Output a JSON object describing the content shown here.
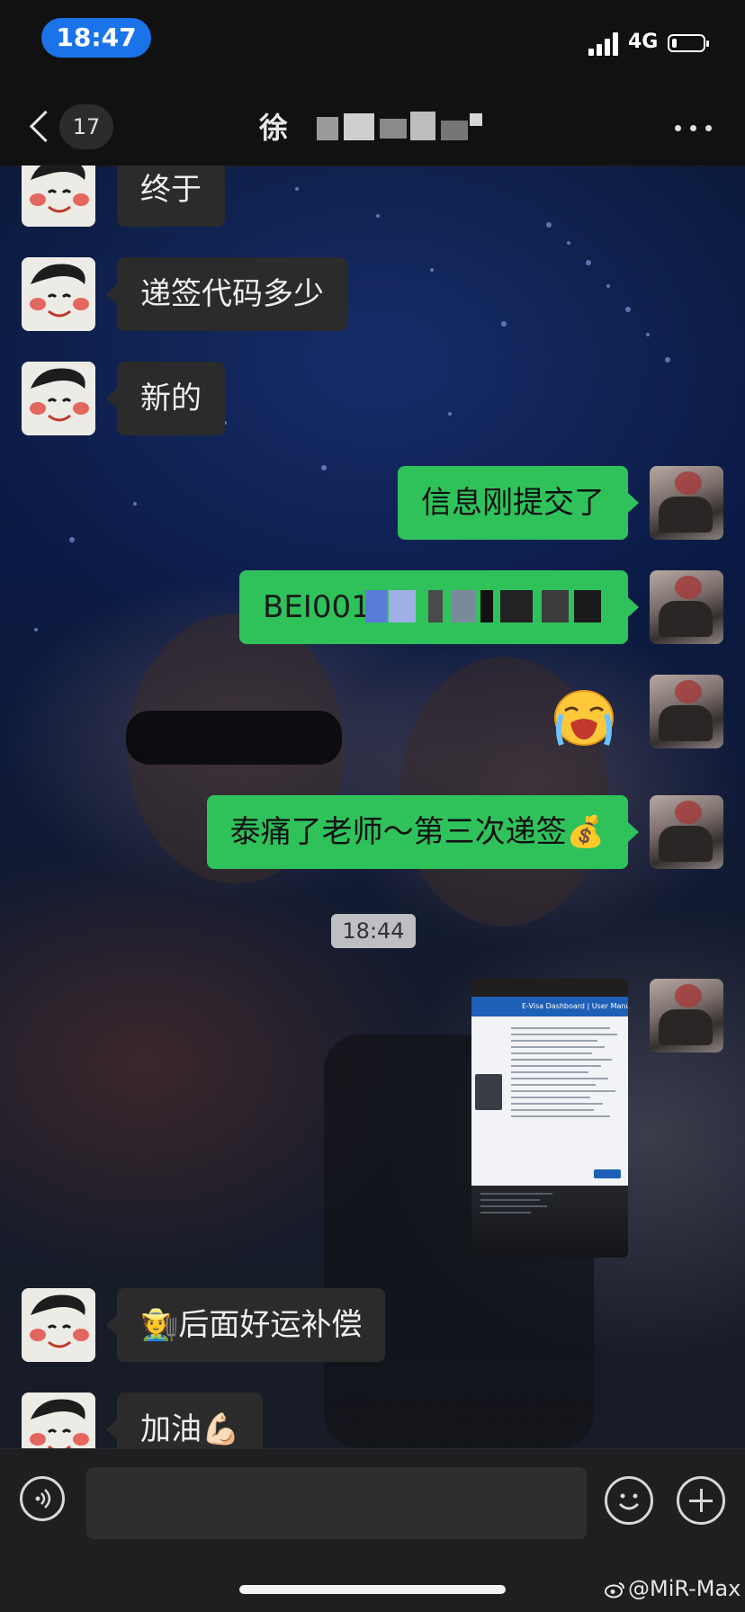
{
  "status_bar": {
    "time": "18:47",
    "network": "4G"
  },
  "nav": {
    "unread_count": "17",
    "title_visible": "徐"
  },
  "messages": [
    {
      "side": "left",
      "text": "终于"
    },
    {
      "side": "left",
      "text": "递签代码多少"
    },
    {
      "side": "left",
      "text": "新的"
    },
    {
      "side": "right",
      "text": "信息刚提交了"
    },
    {
      "side": "right",
      "text": "BEI0012"
    },
    {
      "side": "right",
      "sticker": "crying-face"
    },
    {
      "side": "right",
      "text": "泰痛了老师～第三次递签💰"
    },
    {
      "timestamp": "18:44"
    },
    {
      "side": "right",
      "image": "e-visa-screenshot"
    },
    {
      "side": "left",
      "text": "🧑‍🌾后面好运补偿"
    },
    {
      "side": "left",
      "text": "加油💪🏻"
    }
  ],
  "shared_image": {
    "header_text": "E-Visa Dashboard  |  User Manual"
  },
  "input": {
    "placeholder": ""
  },
  "watermark": "@MiR-Max",
  "colors": {
    "outgoing_bubble": "#2fc25b",
    "incoming_bubble": "#2b2b2b",
    "time_pill": "#1a73e8"
  }
}
